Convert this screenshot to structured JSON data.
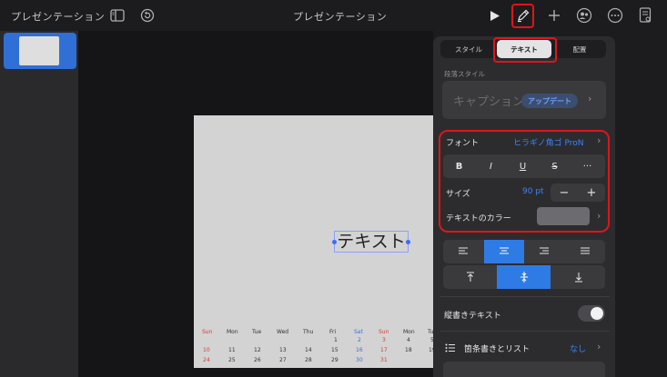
{
  "topbar": {
    "app_title": "プレゼンテーション",
    "doc_title": "プレゼンテーション"
  },
  "slide": {
    "text": "テキスト",
    "calendar": {
      "weekdays": [
        "Sun",
        "Mon",
        "Tue",
        "Wed",
        "Thu",
        "Fri",
        "Sat",
        "Sun",
        "Mon",
        "Tu"
      ],
      "rows": [
        [
          "",
          "",
          "",
          "",
          "",
          "1",
          "2",
          "3",
          "4",
          "5"
        ],
        [
          "10",
          "11",
          "12",
          "13",
          "14",
          "15",
          "16",
          "17",
          "18",
          "19"
        ],
        [
          "24",
          "25",
          "26",
          "27",
          "28",
          "29",
          "30",
          "31",
          "",
          ""
        ]
      ]
    }
  },
  "panel": {
    "tabs": [
      "スタイル",
      "テキスト",
      "配置"
    ],
    "active_tab": "テキスト",
    "paragraph_style_label": "段落スタイル",
    "paragraph_style_value": "キャプション*",
    "update_button": "アップデート",
    "font_label": "フォント",
    "font_value": "ヒラギノ角ゴ ProN",
    "format_buttons": [
      "B",
      "I",
      "U",
      "S",
      "···"
    ],
    "size_label": "サイズ",
    "size_value": "90 pt",
    "size_minus": "−",
    "size_plus": "+",
    "text_color_label": "テキストのカラー",
    "vertical_text_label": "縦書きテキスト",
    "vertical_text_on": false,
    "bullets_label": "箇条書きとリスト",
    "bullets_value": "なし"
  },
  "colors": {
    "accent": "#2f7be5",
    "highlight": "#e0141b"
  }
}
